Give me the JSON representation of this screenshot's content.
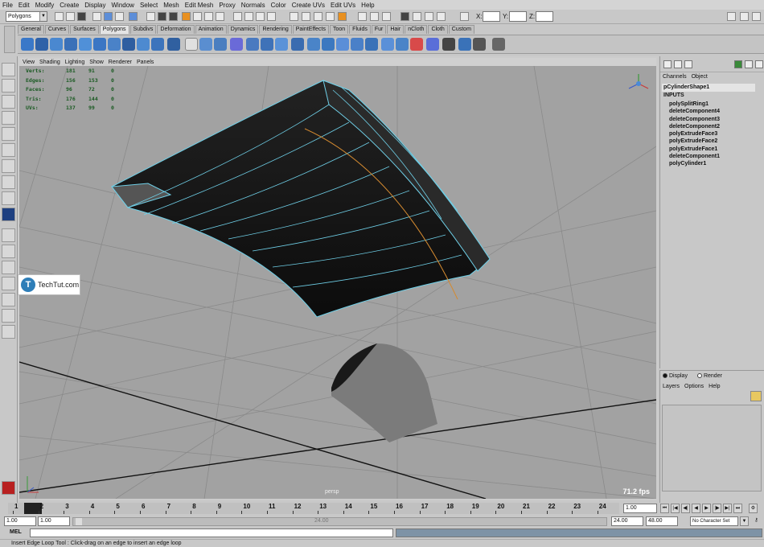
{
  "menu": [
    "File",
    "Edit",
    "Modify",
    "Create",
    "Display",
    "Window",
    "Select",
    "Mesh",
    "Edit Mesh",
    "Proxy",
    "Normals",
    "Color",
    "Create UVs",
    "Edit UVs",
    "Help"
  ],
  "status_line": {
    "menu_set": "Polygons",
    "x_label": "X:",
    "y_label": "Y:",
    "z_label": "Z:"
  },
  "shelf_tabs": [
    "General",
    "Curves",
    "Surfaces",
    "Polygons",
    "Subdivs",
    "Deformation",
    "Animation",
    "Dynamics",
    "Rendering",
    "PaintEffects",
    "Toon",
    "Fluids",
    "Fur",
    "Hair",
    "nCloth",
    "Cloth",
    "Custom"
  ],
  "shelf_active": "Polygons",
  "panel_menu": [
    "View",
    "Shading",
    "Lighting",
    "Show",
    "Renderer",
    "Panels"
  ],
  "hud_stats": [
    {
      "label": "Verts:",
      "a": "181",
      "b": "91",
      "c": "0"
    },
    {
      "label": "Edges:",
      "a": "156",
      "b": "153",
      "c": "0"
    },
    {
      "label": "Faces:",
      "a": "96",
      "b": "72",
      "c": "0"
    },
    {
      "label": "Tris:",
      "a": "176",
      "b": "144",
      "c": "0"
    },
    {
      "label": "UVs:",
      "a": "137",
      "b": "99",
      "c": "0"
    }
  ],
  "camera_name": "persp",
  "fps": "71.2 fps",
  "watermark": {
    "logo": "T",
    "text": "TechTut.com"
  },
  "channel_box": {
    "tabs": [
      "Channels",
      "Object"
    ],
    "object_name": "pCylinderShape1",
    "inputs_header": "INPUTS",
    "history": [
      "polySplitRing1",
      "deleteComponent4",
      "deleteComponent3",
      "deleteComponent2",
      "polyExtrudeFace3",
      "polyExtrudeFace2",
      "polyExtrudeFace1",
      "deleteComponent1",
      "polyCylinder1"
    ]
  },
  "layer_editor": {
    "modes": [
      "Display",
      "Render"
    ],
    "active_mode": "Display",
    "menu": [
      "Layers",
      "Options",
      "Help"
    ]
  },
  "timeline": {
    "ticks": [
      "1",
      "2",
      "3",
      "4",
      "5",
      "6",
      "7",
      "8",
      "9",
      "10",
      "11",
      "12",
      "13",
      "14",
      "15",
      "16",
      "17",
      "18",
      "19",
      "20",
      "21",
      "22",
      "23",
      "24"
    ],
    "current_frame": "1.00"
  },
  "range": {
    "start": "1.00",
    "start_inner": "1.00",
    "slider_mid": "24.00",
    "end_inner": "24.00",
    "end": "48.00",
    "character_set": "No Character Set"
  },
  "command_line": {
    "label": "MEL"
  },
  "help_line": "Insert Edge Loop Tool : Click-drag on an edge to insert an edge loop",
  "colors": {
    "viewport_bg": "#a2a2a2",
    "mesh_dark": "#111111",
    "wire_selected": "#6fd0e8",
    "highlight_edge": "#d48a30",
    "hud_text": "#1a5a22"
  }
}
